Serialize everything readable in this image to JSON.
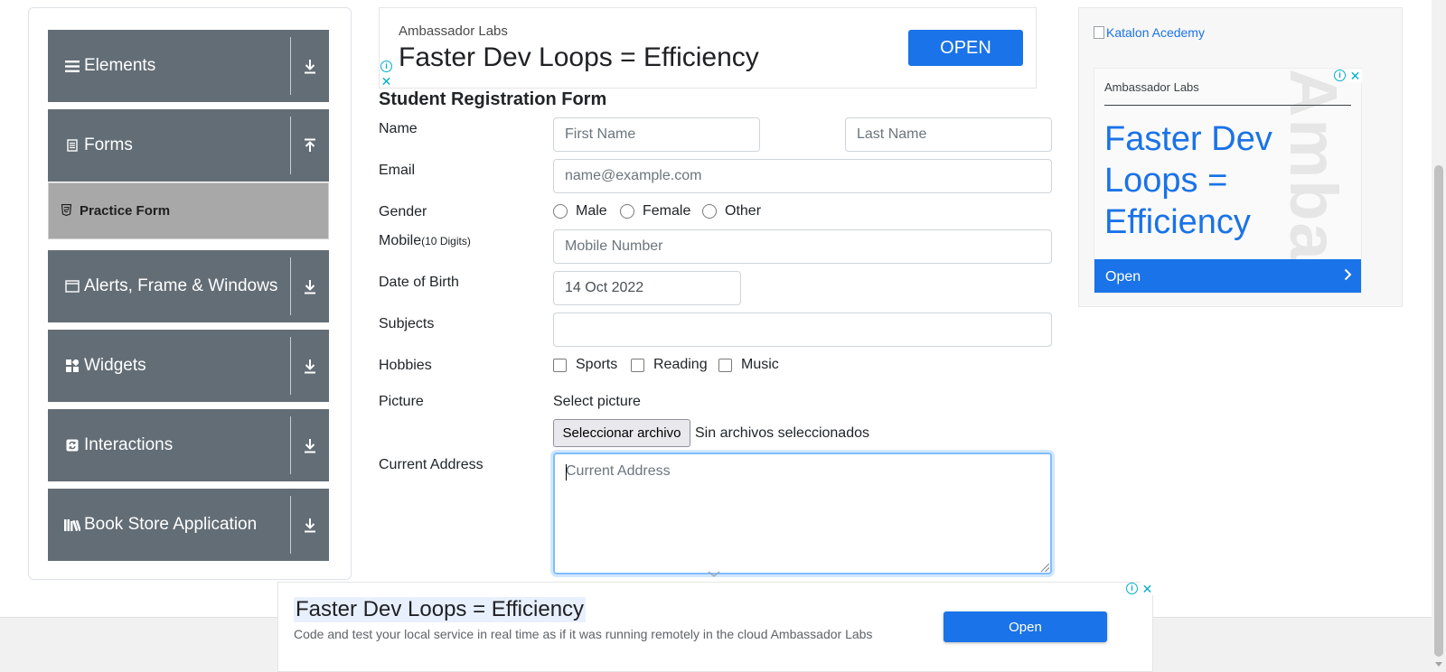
{
  "sidebar": {
    "groups": [
      {
        "label": "Elements",
        "icon": "hamburger-icon",
        "toggle": "download-arrow-icon"
      },
      {
        "label": "Forms",
        "icon": "document-icon",
        "toggle": "upload-arrow-icon"
      },
      {
        "label": "Alerts, Frame & Windows",
        "icon": "window-icon",
        "toggle": "download-arrow-icon"
      },
      {
        "label": "Widgets",
        "icon": "widgets-icon",
        "toggle": "download-arrow-icon"
      },
      {
        "label": "Interactions",
        "icon": "refresh-icon",
        "toggle": "download-arrow-icon"
      },
      {
        "label": "Book Store Application",
        "icon": "books-icon",
        "toggle": "download-arrow-icon"
      }
    ],
    "active_item": "Practice Form"
  },
  "top_ad": {
    "brand": "Ambassador Labs",
    "headline": "Faster Dev Loops = Efficiency",
    "button": "OPEN"
  },
  "form": {
    "title": "Student Registration Form",
    "name_label": "Name",
    "first_name_placeholder": "First Name",
    "last_name_placeholder": "Last Name",
    "email_label": "Email",
    "email_placeholder": "name@example.com",
    "gender_label": "Gender",
    "gender_options": [
      "Male",
      "Female",
      "Other"
    ],
    "mobile_label": "Mobile",
    "mobile_hint": "(10 Digits)",
    "mobile_placeholder": "Mobile Number",
    "dob_label": "Date of Birth",
    "dob_value": "14 Oct 2022",
    "subjects_label": "Subjects",
    "subjects_value": "",
    "hobbies_label": "Hobbies",
    "hobbies_options": [
      "Sports",
      "Reading",
      "Music"
    ],
    "picture_label": "Picture",
    "select_picture": "Select picture",
    "file_button": "Seleccionar archivo",
    "file_status": "Sin archivos seleccionados",
    "address_label": "Current Address",
    "address_placeholder": "Current Address"
  },
  "right_ad": {
    "image_alt": "Katalon Acedemy",
    "brand": "Ambassador Labs",
    "headline": "Faster Dev Loops = Efficiency",
    "watermark": "Ambassador",
    "open_label": "Open"
  },
  "bottom_ad": {
    "headline": "Faster Dev Loops = Efficiency",
    "description": "Code and test your local service in real time as if it was running remotely in the cloud Ambassador Labs",
    "button": "Open"
  },
  "colors": {
    "sidebar_group": "#636d75",
    "sidebar_active": "#a8a8a8",
    "accent_blue": "#1a73e8",
    "focus_border": "#80bdff"
  }
}
